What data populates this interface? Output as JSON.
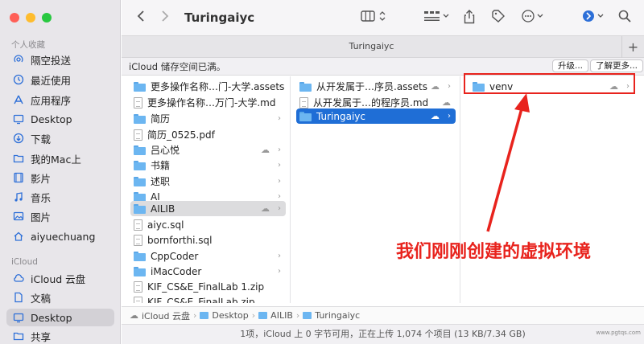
{
  "sidebar": {
    "favorites_heading": "个人收藏",
    "icloud_heading": "iCloud",
    "favorites": [
      {
        "label": "隔空投送",
        "icon": "airdrop-icon"
      },
      {
        "label": "最近使用",
        "icon": "clock-icon"
      },
      {
        "label": "应用程序",
        "icon": "applications-icon"
      },
      {
        "label": "Desktop",
        "icon": "desktop-icon"
      },
      {
        "label": "下载",
        "icon": "download-icon"
      },
      {
        "label": "我的Mac上",
        "icon": "folder-icon"
      },
      {
        "label": "影片",
        "icon": "film-icon"
      },
      {
        "label": "音乐",
        "icon": "music-icon"
      },
      {
        "label": "图片",
        "icon": "photo-icon"
      },
      {
        "label": "aiyuechuang",
        "icon": "home-icon"
      }
    ],
    "icloud": [
      {
        "label": "iCloud 云盘",
        "icon": "cloud-icon"
      },
      {
        "label": "文稿",
        "icon": "document-icon"
      },
      {
        "label": "Desktop",
        "icon": "desktop-icon",
        "active": true
      },
      {
        "label": "共享",
        "icon": "shared-folder-icon"
      }
    ]
  },
  "toolbar": {
    "title": "Turingaiyc"
  },
  "tab": {
    "label": "Turingaiyc",
    "plus": "+"
  },
  "banner": {
    "text": "iCloud 储存空间已满。",
    "upgrade": "升级...",
    "learn_more": "了解更多..."
  },
  "column1": [
    {
      "name": "更多操作名称…门-大学.assets",
      "type": "folder",
      "chevron": true
    },
    {
      "name": "更多操作名称…万门-大学.md",
      "type": "file"
    },
    {
      "name": "简历",
      "type": "folder",
      "chevron": true
    },
    {
      "name": "简历_0525.pdf",
      "type": "file"
    },
    {
      "name": "吕心悦",
      "type": "folder",
      "cloud": true,
      "chevron": true
    },
    {
      "name": "书籍",
      "type": "folder",
      "chevron": true
    },
    {
      "name": "述职",
      "type": "folder",
      "chevron": true
    },
    {
      "name": "AI",
      "type": "folder",
      "chevron": true
    },
    {
      "name": "AILIB",
      "type": "folder",
      "cloud": true,
      "chevron": true,
      "selected": true
    },
    {
      "name": "aiyc.sql",
      "type": "file"
    },
    {
      "name": "bornforthi.sql",
      "type": "file"
    },
    {
      "name": "CppCoder",
      "type": "folder",
      "chevron": true
    },
    {
      "name": "iMacCoder",
      "type": "folder",
      "chevron": true
    },
    {
      "name": "KIF_CS&E_FinalLab 1.zip",
      "type": "file"
    },
    {
      "name": "KIF_CS&E_FinalLab.zip",
      "type": "file"
    }
  ],
  "column2": [
    {
      "name": "从开发属于…序员.assets",
      "type": "folder",
      "cloud": true,
      "chevron": true
    },
    {
      "name": "从开发属于…的程序员.md",
      "type": "file",
      "cloud": true
    },
    {
      "name": "Turingaiyc",
      "type": "folder",
      "cloud": true,
      "chevron": true,
      "selected": true
    }
  ],
  "column3": [
    {
      "name": "venv",
      "type": "folder",
      "cloud": true,
      "chevron": true
    }
  ],
  "annotation": "我们刚刚创建的虚拟环境",
  "pathbar": [
    "iCloud 云盘",
    "Desktop",
    "AILIB",
    "Turingaiyc"
  ],
  "status": "1项，iCloud 上 0 字节可用，正在上传 1,074 个项目 (13 KB/7.34 GB)",
  "watermark": "www.pgtqs.com",
  "colors": {
    "accent": "#1f6ed6",
    "annotation": "#e8231d"
  }
}
